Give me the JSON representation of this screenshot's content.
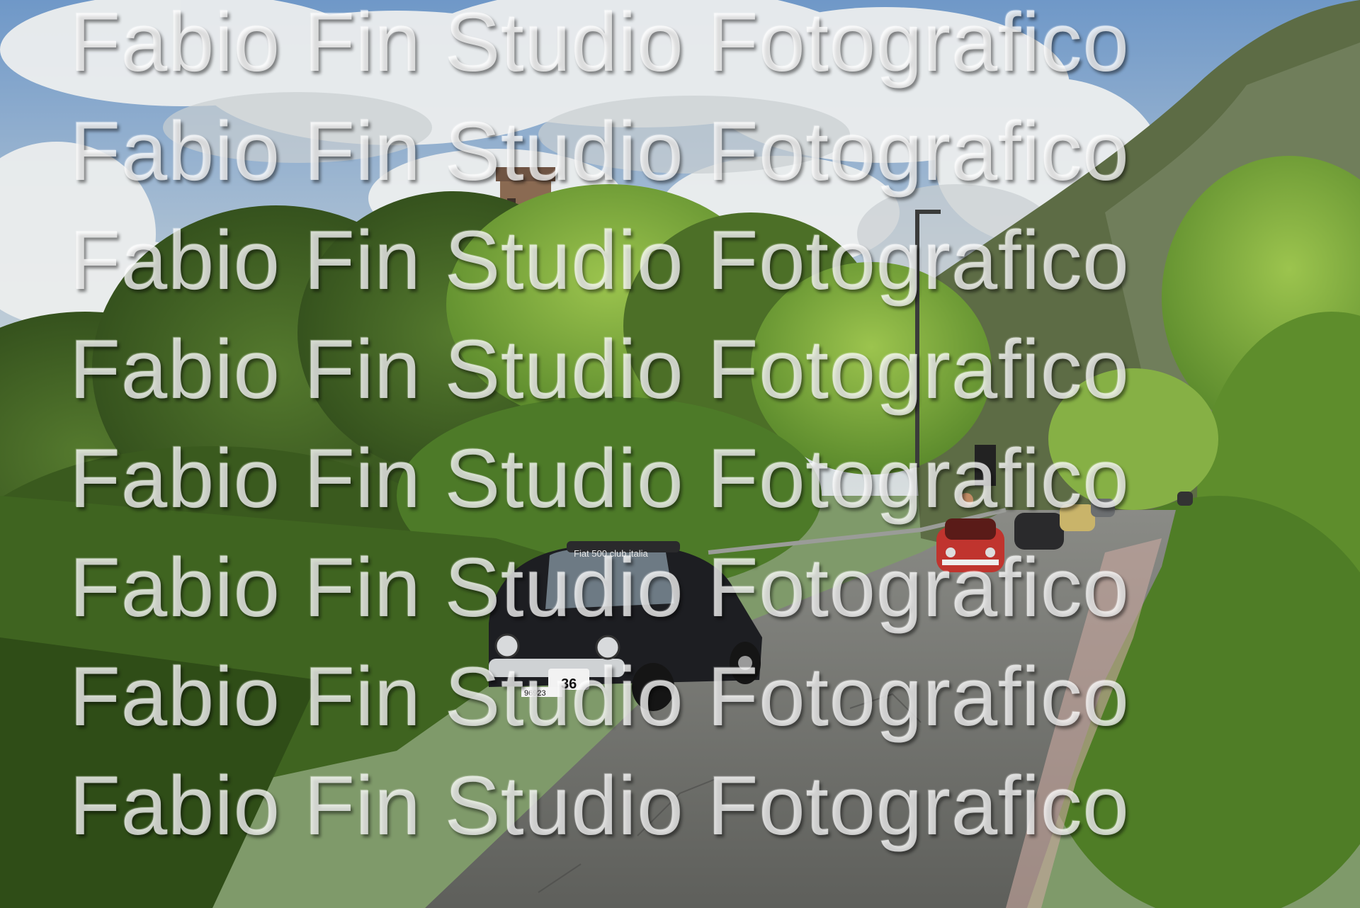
{
  "watermark": {
    "text": "Fabio Fin Studio Fotografico",
    "lines": [
      "Fabio Fin Studio Fotografico",
      "Fabio Fin Studio Fotografico",
      "Fabio Fin Studio Fotografico",
      "Fabio Fin Studio Fotografico",
      "Fabio Fin Studio Fotografico",
      "Fabio Fin Studio Fotografico",
      "Fabio Fin Studio Fotografico",
      "Fabio Fin Studio Fotografico"
    ]
  },
  "scene": {
    "car_windshield_text": "Fiat 500 club italia",
    "car_race_number": "36",
    "car_plate": "96923",
    "colors": {
      "sky": "#8fb0d2",
      "cloud": "#eef0f0",
      "foliage_dark": "#3d5a22",
      "foliage_light": "#7ca63c",
      "road": "#6f6f6c",
      "car_front": "#1f2024",
      "car_red": "#c0342e",
      "mountain": "#5e6e48"
    }
  }
}
